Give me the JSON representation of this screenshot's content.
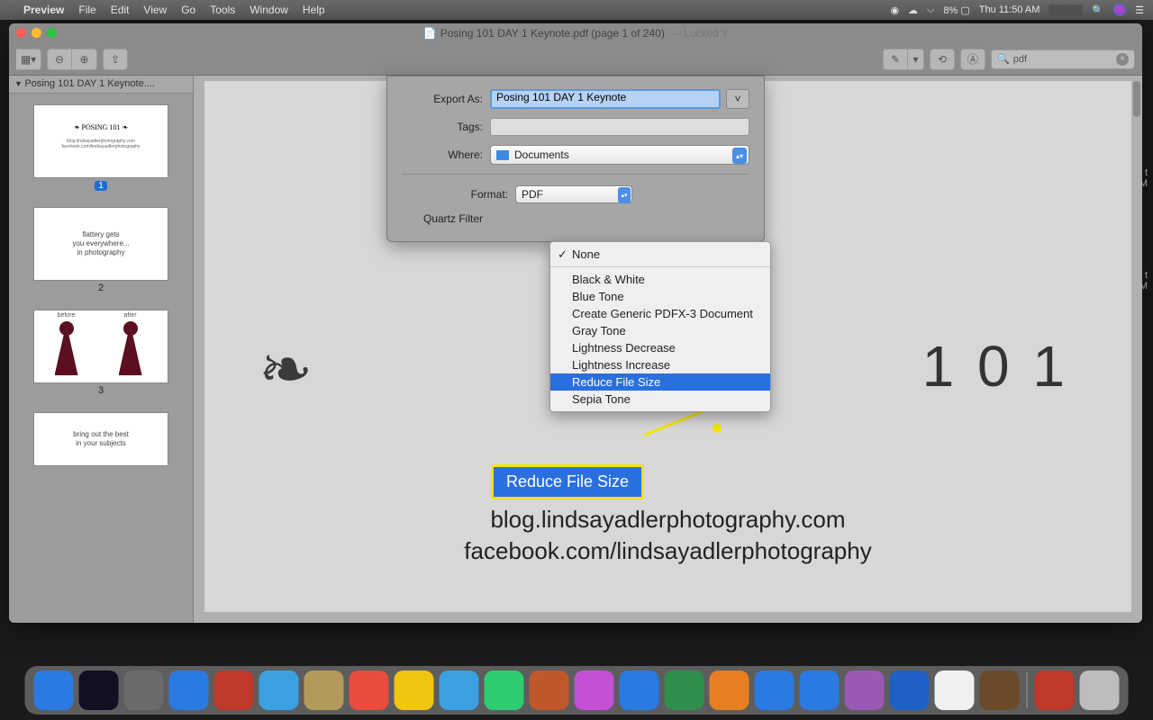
{
  "menubar": {
    "app": "Preview",
    "items": [
      "File",
      "Edit",
      "View",
      "Go",
      "Tools",
      "Window",
      "Help"
    ],
    "battery": "8%",
    "clock": "Thu 11:50 AM"
  },
  "window": {
    "title": "Posing 101 DAY 1 Keynote.pdf (page 1 of 240)",
    "locked": "— Locked ˅",
    "search_value": "pdf"
  },
  "sidebar": {
    "header": "Posing 101 DAY 1 Keynote....",
    "page1_badge": "1",
    "page2_label": "2",
    "page2_text": "flattery gets\nyou everywhere...\nin photography",
    "page3_label": "3",
    "page3_before": "before",
    "page3_after": "after",
    "page4_text": "bring out the best\nin your subjects"
  },
  "page": {
    "title_fragment": "1 0 1",
    "link1": "blog.lindsayadlerphotography.com",
    "link2": "facebook.com/lindsayadlerphotography"
  },
  "callout": {
    "text": "Reduce File Size"
  },
  "sheet": {
    "export_as_label": "Export As:",
    "export_as_value": "Posing 101 DAY 1 Keynote",
    "tags_label": "Tags:",
    "where_label": "Where:",
    "where_value": "Documents",
    "format_label": "Format:",
    "format_value": "PDF",
    "quartz_label": "Quartz Filter"
  },
  "menu": {
    "selected": "None",
    "items": [
      "Black & White",
      "Blue Tone",
      "Create Generic PDFX-3 Document",
      "Gray Tone",
      "Lightness Decrease",
      "Lightness Increase",
      "Reduce File Size",
      "Sepia Tone"
    ],
    "highlight": "Reduce File Size"
  },
  "dock_colors": [
    "#2a7ae2",
    "#101022",
    "#6b6b6b",
    "#2a7ae2",
    "#c0392b",
    "#3aa0e0",
    "#b49a5a",
    "#e74c3c",
    "#f1c40f",
    "#3aa0e0",
    "#2ecc71",
    "#c0572a",
    "#c450d4",
    "#2a7ae2",
    "#2f8f4d",
    "#e67e22",
    "#2a7ae2",
    "#2a7ae2",
    "#9b59b6",
    "#1f60c4",
    "#f0f0f0",
    "#6b4a2a",
    "#c0392b",
    "#bdbdbd"
  ]
}
